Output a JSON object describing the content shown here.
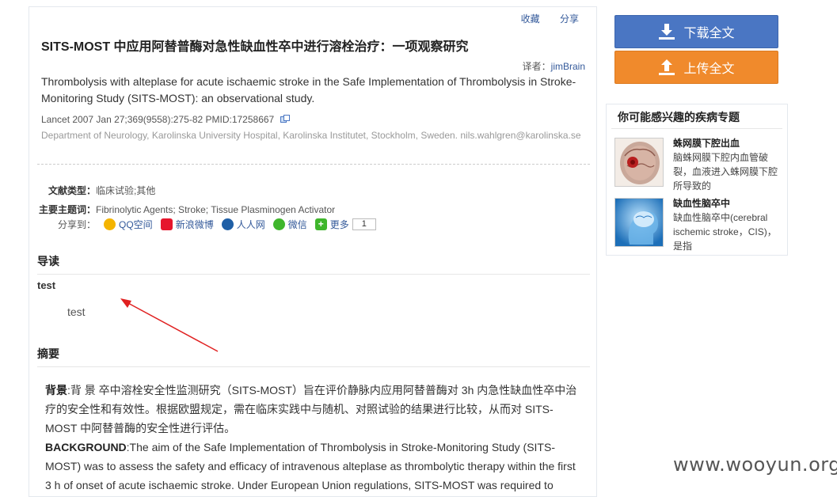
{
  "article": {
    "actions": {
      "favorite": "收藏",
      "share": "分享"
    },
    "title": "SITS-MOST 中应用阿替普酶对急性缺血性卒中进行溶栓治疗：一项观察研究",
    "translator_label": "译者：",
    "translator": "jimBrain",
    "english_title": "Thrombolysis with alteplase for acute ischaemic stroke in the Safe Implementation of Thrombolysis in Stroke-Monitoring Study (SITS-MOST): an observational study.",
    "citation": "Lancet 2007 Jan 27;369(9558):275-82 PMID:17258667",
    "affiliation": "Department of Neurology, Karolinska University Hospital, Karolinska Institutet, Stockholm, Sweden. nils.wahlgren@karolinska.se",
    "doc_type_label": "文献类型：",
    "doc_type": "临床试验;其他",
    "subject_label": "主要主题词：",
    "subject": "Fibrinolytic Agents; Stroke; Tissue Plasminogen Activator",
    "share_label": "分享到：",
    "share_items": [
      {
        "label": "QQ空间",
        "color": "#f4b400",
        "icon": "qzone-icon"
      },
      {
        "label": "新浪微博",
        "color": "#e6162d",
        "icon": "weibo-icon"
      },
      {
        "label": "人人网",
        "color": "#1f5fa6",
        "icon": "renren-icon"
      },
      {
        "label": "微信",
        "color": "#3fb62c",
        "icon": "wechat-icon"
      },
      {
        "label": "更多",
        "color": "#3fb62c",
        "icon": "more-icon"
      }
    ],
    "share_count": "1",
    "guide_heading": "导读",
    "guide_title": "test",
    "guide_text": "test",
    "abstract_heading": "摘要",
    "abstract": {
      "cn_label": "背景",
      "cn_text": ":背 景 卒中溶栓安全性监测研究（SITS-MOST）旨在评价静脉内应用阿替普酶对 3h 内急性缺血性卒中治疗的安全性和有效性。根据欧盟规定，需在临床实践中与随机、对照试验的结果进行比较，从而对 SITS-MOST 中阿替普酶的安全性进行评估。",
      "en_label": "BACKGROUND",
      "en_text": ":The aim of the Safe Implementation of Thrombolysis in Stroke-Monitoring Study (SITS-MOST) was to assess the safety and efficacy of intravenous alteplase as thrombolytic therapy within the first 3 h of onset of acute ischaemic stroke. Under European Union regulations, SITS-MOST was required to"
    }
  },
  "sidebar": {
    "download_label": "下载全文",
    "upload_label": "上传全文",
    "download_color": "#4a76c3",
    "upload_color": "#f08a2c",
    "topics_heading": "你可能感兴趣的疾病专题",
    "topics": [
      {
        "title": "蛛网膜下腔出血",
        "desc": "脑蛛网膜下腔内血管破裂，血液进入蛛网膜下腔所导致的"
      },
      {
        "title": "缺血性脑卒中",
        "desc": "缺血性脑卒中(cerebral ischemic stroke，CIS)，是指"
      }
    ]
  },
  "watermark": "www.wooyun.org",
  "annotation_color": "#e02020"
}
